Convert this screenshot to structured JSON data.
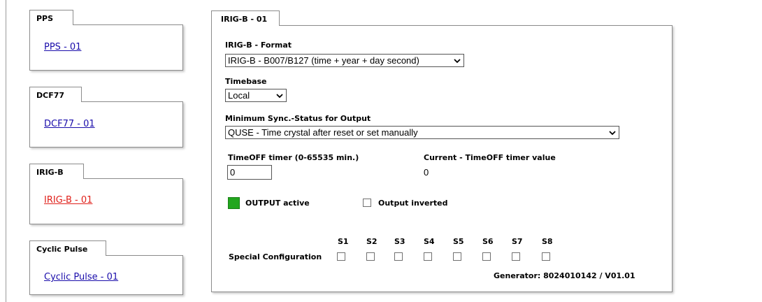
{
  "left_panels": [
    {
      "tab": "PPS",
      "link": "PPS - 01",
      "active": false
    },
    {
      "tab": "DCF77",
      "link": "DCF77 - 01",
      "active": false
    },
    {
      "tab": "IRIG-B",
      "link": "IRIG-B - 01",
      "active": true
    },
    {
      "tab": "Cyclic Pulse",
      "link": "Cyclic Pulse - 01",
      "active": false
    }
  ],
  "main": {
    "tab": "IRIG-B - 01",
    "format_label": "IRIG-B - Format",
    "format_value": "IRIG-B - B007/B127 (time + year + day second)",
    "timebase_label": "Timebase",
    "timebase_value": "Local",
    "min_sync_label": "Minimum Sync.-Status for Output",
    "min_sync_value": "QUSE - Time crystal after reset or set manually",
    "timeoff_label": "TimeOFF timer (0-65535 min.)",
    "timeoff_value": "0",
    "current_timeoff_label": "Current - TimeOFF timer value",
    "current_timeoff_value": "0",
    "output_active_label": "OUTPUT active",
    "output_active_color": "#22a61e",
    "output_inverted_label": "Output inverted",
    "special_config_label": "Special Configuration",
    "switches": [
      "S1",
      "S2",
      "S3",
      "S4",
      "S5",
      "S6",
      "S7",
      "S8"
    ],
    "generator": "Generator: 8024010142 / V01.01"
  }
}
